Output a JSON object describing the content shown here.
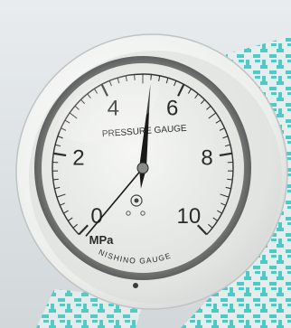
{
  "gauge": {
    "scale_labels": [
      "0",
      "2",
      "4",
      "6",
      "8",
      "10"
    ],
    "title": "PRESSURE GAUGE",
    "unit": "MPa",
    "brand": "NISHINO GAUGE",
    "reading_fraction": 0.52,
    "needle_color": "#1a1a1a",
    "dial_color": "#eef0ec",
    "rim_color": "#f2f3f1",
    "accent_color": "#3ec7c3"
  }
}
